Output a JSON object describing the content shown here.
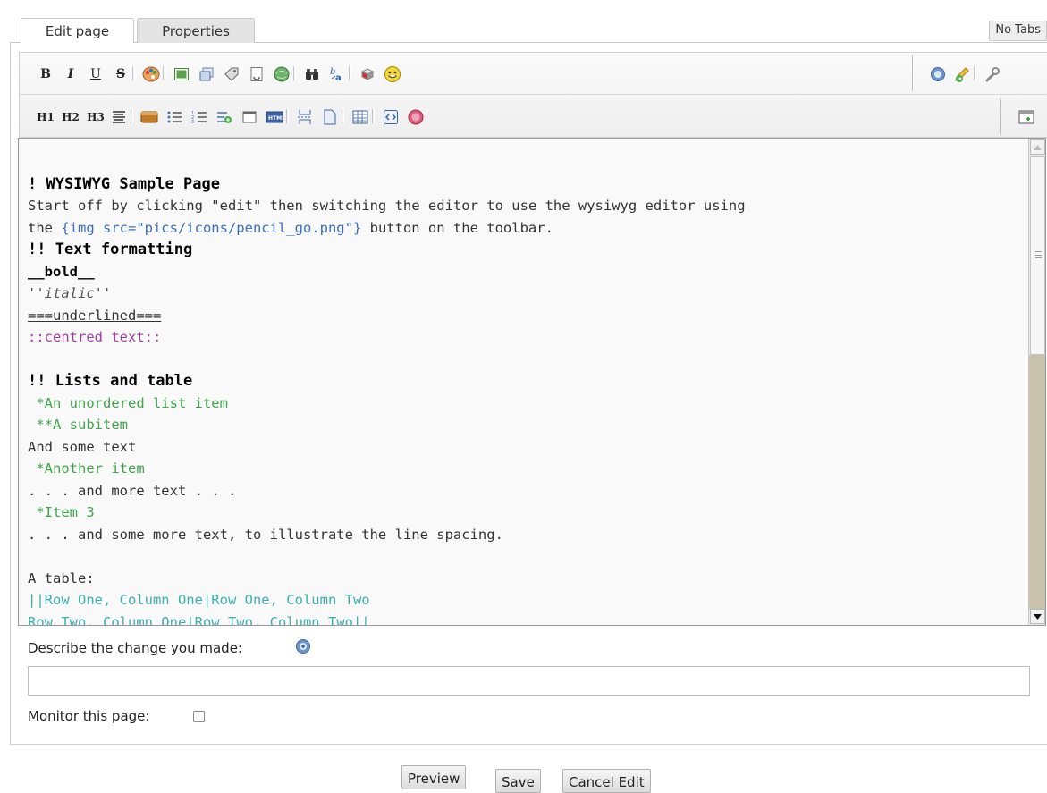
{
  "tabs": [
    {
      "label": "Edit page",
      "active": true
    },
    {
      "label": "Properties",
      "active": false
    }
  ],
  "no_tabs_label": "No Tabs",
  "toolbar": {
    "row1_text_buttons": [
      "B",
      "I",
      "U",
      "S"
    ],
    "row2_text_buttons": [
      "H1",
      "H2",
      "H3"
    ]
  },
  "editor": {
    "lines": [
      {
        "text": "! WYSIWYG Sample Page",
        "style": "h"
      },
      {
        "text": "Start off by clicking \"edit\" then switching the editor to use the wysiwyg editor using",
        "style": "plain"
      },
      {
        "prefix": "the ",
        "link": "{img src=\"pics/icons/pencil_go.png\"}",
        "suffix": " button on the toolbar.",
        "style": "mixed"
      },
      {
        "text": "!! Text formatting",
        "style": "h"
      },
      {
        "text": "__bold__",
        "style": "bold"
      },
      {
        "text": "''italic''",
        "style": "it"
      },
      {
        "text": "===underlined===",
        "style": "ul"
      },
      {
        "text": "::centred text::",
        "style": "ctr"
      },
      {
        "text": "",
        "style": "plain"
      },
      {
        "text": "!! Lists and table",
        "style": "h"
      },
      {
        "text": " *An unordered list item",
        "style": "li"
      },
      {
        "text": " **A subitem",
        "style": "li"
      },
      {
        "text": "And some text",
        "style": "plain"
      },
      {
        "text": " *Another item",
        "style": "li"
      },
      {
        "text": ". . . and more text . . .",
        "style": "plain"
      },
      {
        "text": " *Item 3",
        "style": "li"
      },
      {
        "text": ". . . and some more text, to illustrate the line spacing.",
        "style": "plain"
      },
      {
        "text": "",
        "style": "plain"
      },
      {
        "text": "A table:",
        "style": "plain"
      },
      {
        "text": "||Row One, Column One|Row One, Column Two",
        "style": "tbl"
      },
      {
        "text": "Row Two, Column One|Row Two, Column Two||",
        "style": "tbl"
      }
    ]
  },
  "describe_label": "Describe the change you made:",
  "describe_value": "",
  "monitor_label": "Monitor this page:",
  "monitor_checked": false,
  "buttons": {
    "preview": "Preview",
    "save": "Save",
    "cancel": "Cancel Edit"
  }
}
